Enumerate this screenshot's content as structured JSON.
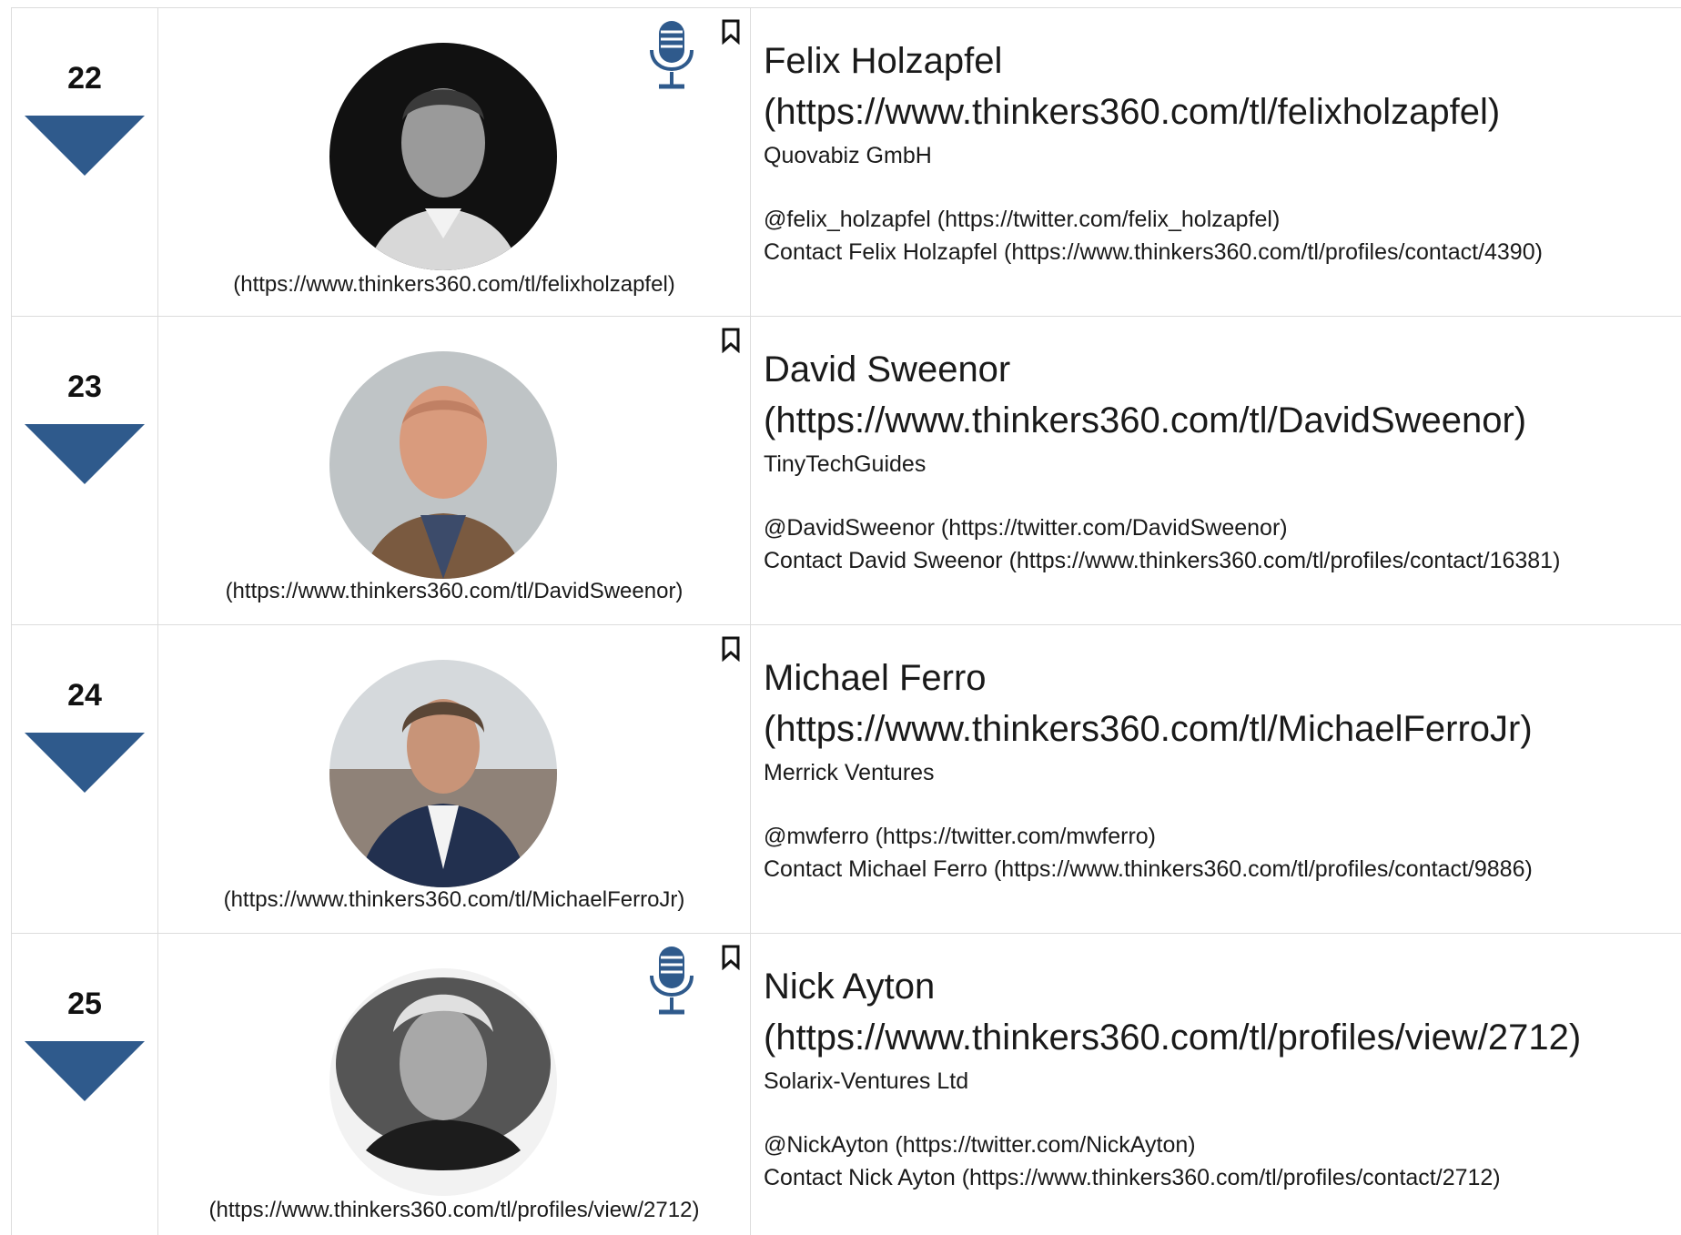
{
  "colors": {
    "accent": "#2f5a8c",
    "border": "#dcdcdc",
    "text": "#1a1a1a"
  },
  "rows": [
    {
      "rank": "22",
      "photo_link": "(https://www.thinkers360.com/tl/felixholzapfel)",
      "has_podcast": true,
      "name": "Felix Holzapfel",
      "name_link": "(https://www.thinkers360.com/tl/felixholzapfel)",
      "company": "Quovabiz GmbH",
      "twitter": "@felix_holzapfel (https://twitter.com/felix_holzapfel)",
      "contact": "Contact Felix Holzapfel (https://www.thinkers360.com/tl/profiles/contact/4390)"
    },
    {
      "rank": "23",
      "photo_link": "(https://www.thinkers360.com/tl/DavidSweenor)",
      "has_podcast": false,
      "name": "David Sweenor",
      "name_link": "(https://www.thinkers360.com/tl/DavidSweenor)",
      "company": "TinyTechGuides",
      "twitter": "@DavidSweenor (https://twitter.com/DavidSweenor)",
      "contact": "Contact David Sweenor (https://www.thinkers360.com/tl/profiles/contact/16381)"
    },
    {
      "rank": "24",
      "photo_link": "(https://www.thinkers360.com/tl/MichaelFerroJr)",
      "has_podcast": false,
      "name": "Michael Ferro",
      "name_link": "(https://www.thinkers360.com/tl/MichaelFerroJr)",
      "company": "Merrick Ventures",
      "twitter": "@mwferro (https://twitter.com/mwferro)",
      "contact": "Contact Michael Ferro (https://www.thinkers360.com/tl/profiles/contact/9886)"
    },
    {
      "rank": "25",
      "photo_link": "(https://www.thinkers360.com/tl/profiles/view/2712)",
      "has_podcast": true,
      "name": "Nick Ayton",
      "name_link": "(https://www.thinkers360.com/tl/profiles/view/2712)",
      "company": "Solarix-Ventures Ltd",
      "twitter": "@NickAyton (https://twitter.com/NickAyton)",
      "contact": "Contact Nick Ayton (https://www.thinkers360.com/tl/profiles/contact/2712)"
    }
  ]
}
